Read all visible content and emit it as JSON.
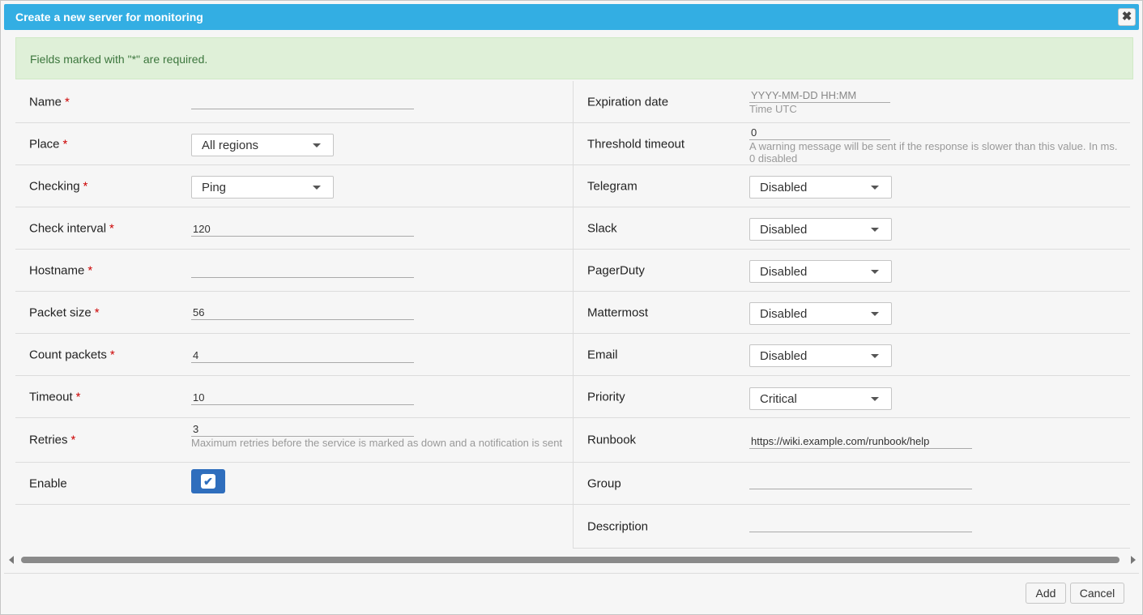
{
  "dialog": {
    "title": "Create a new server for monitoring",
    "close_label": "✖"
  },
  "alert": {
    "text": "Fields marked with \"*\" are required."
  },
  "left": {
    "name": {
      "label": "Name",
      "value": ""
    },
    "place": {
      "label": "Place",
      "value": "All regions"
    },
    "checking": {
      "label": "Checking",
      "value": "Ping"
    },
    "check_interval": {
      "label": "Check interval",
      "value": "120"
    },
    "hostname": {
      "label": "Hostname",
      "value": ""
    },
    "packet_size": {
      "label": "Packet size",
      "value": "56"
    },
    "count_packets": {
      "label": "Count packets",
      "value": "4"
    },
    "timeout": {
      "label": "Timeout",
      "value": "10"
    },
    "retries": {
      "label": "Retries",
      "value": "3",
      "hint": "Maximum retries before the service is marked as down and a notification is sent"
    },
    "enable": {
      "label": "Enable",
      "checked": true,
      "check_glyph": "✔"
    },
    "required_marker": "*"
  },
  "right": {
    "expiration_date": {
      "label": "Expiration date",
      "placeholder": "YYYY-MM-DD HH:MM",
      "hint": "Time UTC"
    },
    "threshold_timeout": {
      "label": "Threshold timeout",
      "value": "0",
      "hint": "A warning message will be sent if the response is slower than this value. In ms. 0 disabled"
    },
    "telegram": {
      "label": "Telegram",
      "value": "Disabled"
    },
    "slack": {
      "label": "Slack",
      "value": "Disabled"
    },
    "pagerduty": {
      "label": "PagerDuty",
      "value": "Disabled"
    },
    "mattermost": {
      "label": "Mattermost",
      "value": "Disabled"
    },
    "email": {
      "label": "Email",
      "value": "Disabled"
    },
    "priority": {
      "label": "Priority",
      "value": "Critical"
    },
    "runbook": {
      "label": "Runbook",
      "value": "https://wiki.example.com/runbook/help"
    },
    "group": {
      "label": "Group",
      "value": ""
    },
    "description": {
      "label": "Description",
      "value": ""
    }
  },
  "footer": {
    "add_label": "Add",
    "cancel_label": "Cancel"
  },
  "colors": {
    "titlebar": "#33aee3",
    "alert_bg": "#dff0d8",
    "alert_text": "#3c763d",
    "checkbox": "#2f6ebd",
    "required": "#cc0000"
  }
}
